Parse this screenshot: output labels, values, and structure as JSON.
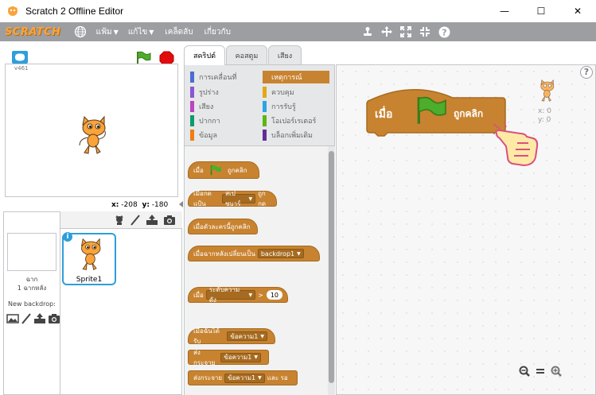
{
  "window": {
    "title": "Scratch 2 Offline Editor",
    "minimize": "—",
    "maximize": "☐",
    "close": "✕"
  },
  "menubar": {
    "logo": "SCRATCH",
    "items": [
      {
        "label": "แฟ้ม",
        "has_caret": true
      },
      {
        "label": "แก้ไข",
        "has_caret": true
      },
      {
        "label": "เคล็ดลับ",
        "has_caret": false
      },
      {
        "label": "เกี่ยวกับ",
        "has_caret": false
      }
    ],
    "caret": "▼"
  },
  "stage": {
    "version": "v461",
    "x_label": "x:",
    "x_value": "-208",
    "y_label": "y:",
    "y_value": "-180"
  },
  "sprites": {
    "stage_label_1": "ฉาก",
    "stage_label_2": "1 ฉากหลัง",
    "new_backdrop": "New backdrop:",
    "sprite_name": "Sprite1",
    "info": "i"
  },
  "tabs": [
    {
      "label": "สคริปต์",
      "active": true
    },
    {
      "label": "คอสตูม",
      "active": false
    },
    {
      "label": "เสียง",
      "active": false
    }
  ],
  "categories": [
    {
      "label": "การเคลื่อนที่",
      "color": "#4a6cd4"
    },
    {
      "label": "เหตุการณ์",
      "color": "#c88330",
      "selected": true
    },
    {
      "label": "รูปร่าง",
      "color": "#8a55d7"
    },
    {
      "label": "ควบคุม",
      "color": "#e1a91a"
    },
    {
      "label": "เสียง",
      "color": "#bb42c3"
    },
    {
      "label": "การรับรู้",
      "color": "#2ca5e2"
    },
    {
      "label": "ปากกา",
      "color": "#0e9a6c"
    },
    {
      "label": "โอเปอร์เรเตอร์",
      "color": "#5cb712"
    },
    {
      "label": "ข้อมูล",
      "color": "#ee7d16"
    },
    {
      "label": "บล็อกเพิ่มเติม",
      "color": "#632d99"
    }
  ],
  "palette_blocks": {
    "b1_text1": "เมื่อ",
    "b1_text2": "ถูกคลิก",
    "b2_text1": "เมื่อกดแป้น",
    "b2_dd": "สเปซบาร์",
    "b2_text2": "ถูกกด",
    "b3_text": "เมื่อตัวละครนี้ถูกคลิก",
    "b4_text": "เมื่อฉากหลังเปลี่ยนเป็น",
    "b4_dd": "backdrop1",
    "b5_text1": "เมื่อ",
    "b5_dd": "ระดับความดัง",
    "b5_op": ">",
    "b5_num": "10",
    "b6_text": "เมื่อฉันได้รับ",
    "b6_dd": "ข้อความ1",
    "b7_text": "ส่งกระจาย",
    "b7_dd": "ข้อความ1",
    "b8_text": "ส่งกระจาย",
    "b8_dd": "ข้อความ1",
    "b8_text2": "และ รอ"
  },
  "script": {
    "hat_text1": "เมื่อ",
    "hat_text2": "ถูกคลิก",
    "sprite_x": "x: 0",
    "sprite_y": "y: 0",
    "help": "?"
  },
  "colors": {
    "events": "#c88330",
    "menubar": "#9c9ea2",
    "selected_sprite": "#2e9edc"
  }
}
